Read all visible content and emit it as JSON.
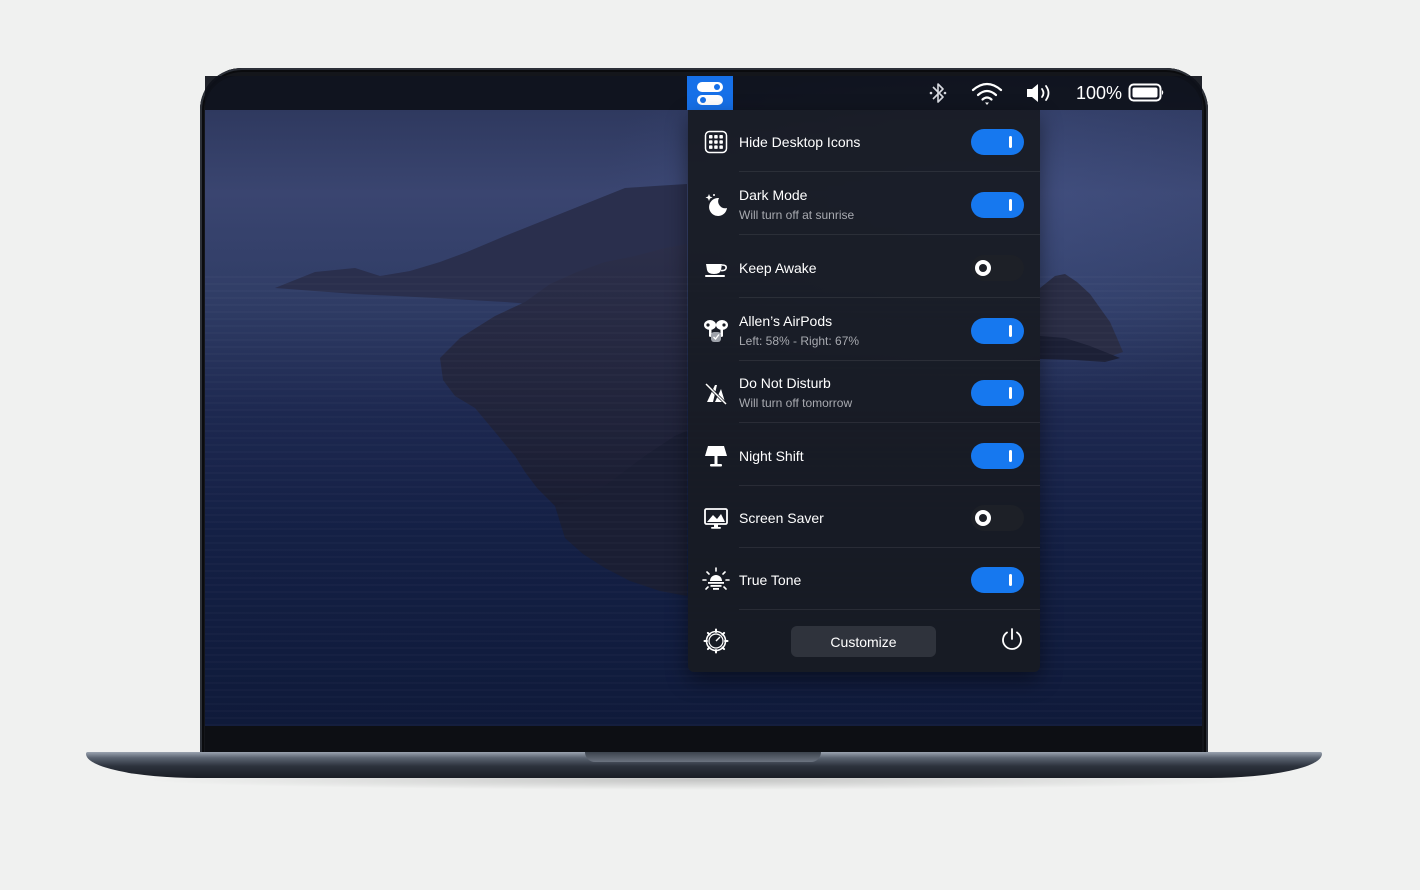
{
  "menubar": {
    "app_icon": "toggles-icon",
    "status_icons": [
      "bluetooth-icon",
      "wifi-icon",
      "volume-icon"
    ],
    "battery_percent": "100%",
    "battery_icon": "battery-icon"
  },
  "panel": {
    "items": [
      {
        "title": "Hide Desktop Icons",
        "subtitle": "",
        "icon": "desktop-grid-icon",
        "enabled": true
      },
      {
        "title": "Dark Mode",
        "subtitle": "Will turn off at sunrise",
        "icon": "moon-icon",
        "enabled": true
      },
      {
        "title": "Keep Awake",
        "subtitle": "",
        "icon": "coffee-cup-icon",
        "enabled": false
      },
      {
        "title": "Allen’s AirPods",
        "subtitle": "Left: 58% - Right: 67%",
        "icon": "airpods-icon",
        "enabled": true
      },
      {
        "title": "Do Not Disturb",
        "subtitle": "Will turn off tomorrow",
        "icon": "do-not-disturb-icon",
        "enabled": true
      },
      {
        "title": "Night Shift",
        "subtitle": "",
        "icon": "lamp-icon",
        "enabled": true
      },
      {
        "title": "Screen Saver",
        "subtitle": "",
        "icon": "monitor-icon",
        "enabled": false
      },
      {
        "title": "True Tone",
        "subtitle": "",
        "icon": "sun-icon",
        "enabled": true
      }
    ],
    "footer": {
      "customize_label": "Customize",
      "settings_icon": "gear-icon",
      "power_icon": "power-icon"
    }
  },
  "colors": {
    "accent": "#1678ef",
    "menubar_app_bg": "#1670e8",
    "panel_bg": "#181b22",
    "toggle_off": "#1d2027"
  }
}
